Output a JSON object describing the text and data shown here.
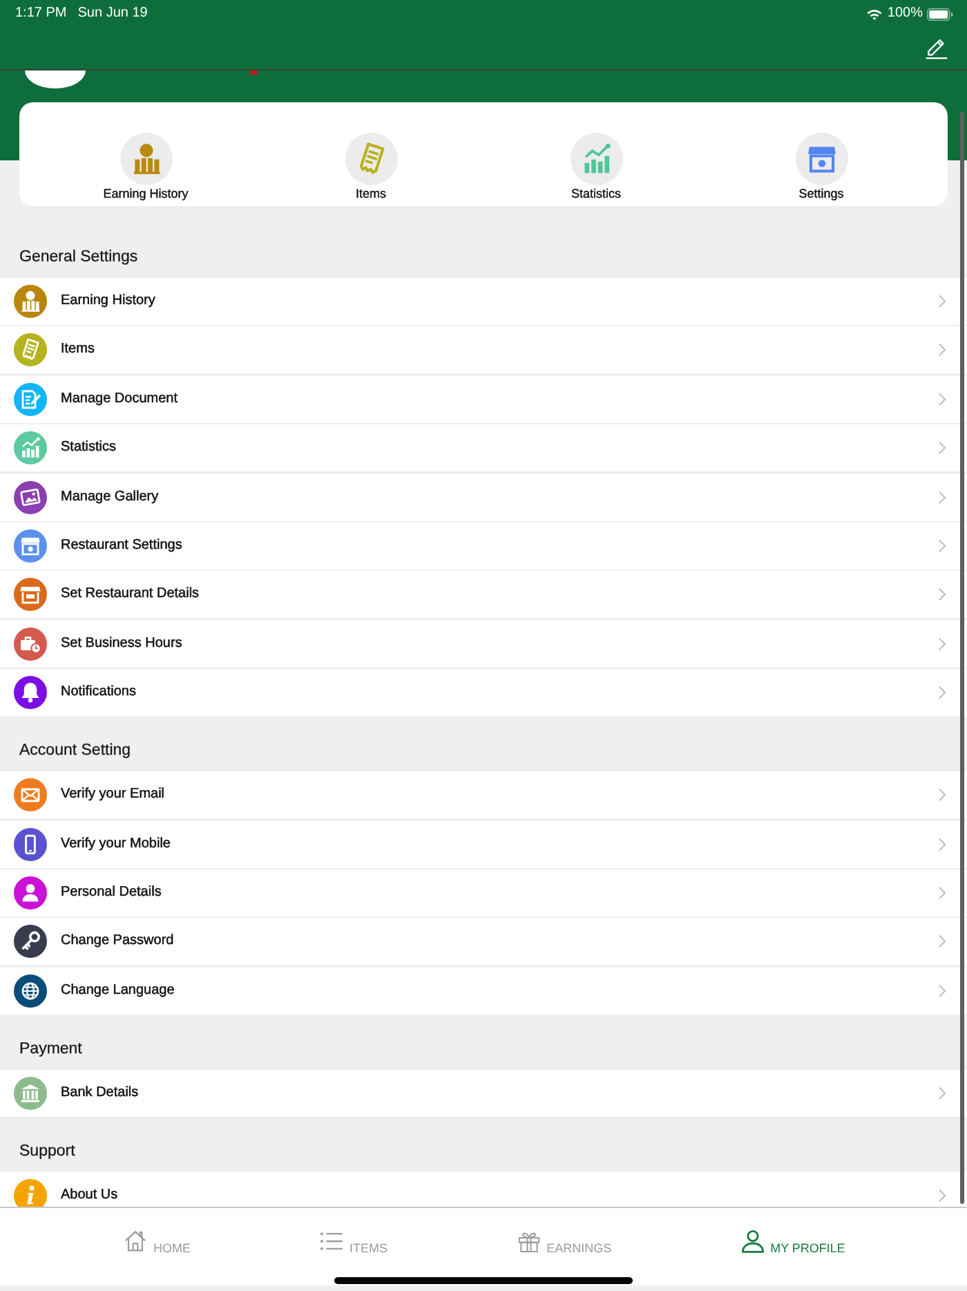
{
  "status_bar": {
    "time": "1:17 PM",
    "date": "Sun Jun 19",
    "battery": "100%"
  },
  "quick_actions": [
    {
      "label": "Earning History"
    },
    {
      "label": "Items"
    },
    {
      "label": "Statistics"
    },
    {
      "label": "Settings"
    }
  ],
  "sections": [
    {
      "title": "General Settings",
      "items": [
        {
          "label": "Earning History"
        },
        {
          "label": "Items"
        },
        {
          "label": "Manage Document"
        },
        {
          "label": "Statistics"
        },
        {
          "label": "Manage Gallery"
        },
        {
          "label": "Restaurant Settings"
        },
        {
          "label": "Set Restaurant Details"
        },
        {
          "label": "Set Business Hours"
        },
        {
          "label": "Notifications"
        }
      ]
    },
    {
      "title": "Account Setting",
      "items": [
        {
          "label": "Verify your Email"
        },
        {
          "label": "Verify your Mobile"
        },
        {
          "label": "Personal Details"
        },
        {
          "label": "Change Password"
        },
        {
          "label": "Change Language"
        }
      ]
    },
    {
      "title": "Payment",
      "items": [
        {
          "label": "Bank Details"
        }
      ]
    },
    {
      "title": "Support",
      "items": [
        {
          "label": "About Us"
        }
      ]
    }
  ],
  "tab_bar": {
    "tabs": [
      {
        "label": "HOME",
        "selected": false
      },
      {
        "label": "ITEMS",
        "selected": false
      },
      {
        "label": "EARNINGS",
        "selected": false
      },
      {
        "label": "MY PROFILE",
        "selected": true
      }
    ]
  }
}
